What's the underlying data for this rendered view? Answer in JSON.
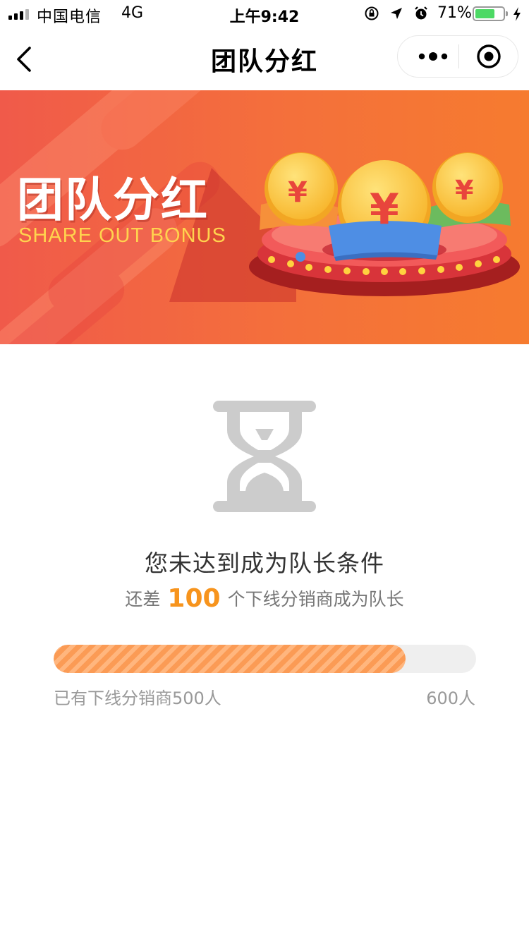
{
  "status_bar": {
    "carrier": "中国电信",
    "network": "4G",
    "time": "上午9:42",
    "battery_text": "71%",
    "battery_level": 0.71,
    "icons": [
      "signal-icon",
      "rotation-lock-icon",
      "location-arrow-icon",
      "alarm-icon",
      "battery-icon",
      "charging-icon"
    ]
  },
  "nav": {
    "title": "团队分红",
    "icons": [
      "back-chevron-icon",
      "more-dots-icon",
      "close-target-icon"
    ]
  },
  "banner": {
    "title": "团队分红",
    "subtitle": "SHARE OUT BONUS",
    "coin_symbol": "¥",
    "colors": {
      "background": "#f27a3a",
      "title": "#ffffff",
      "subtitle": "#ffd34e",
      "coin": "#ffcc3c"
    }
  },
  "status": {
    "icon": "hourglass-icon",
    "headline": "您未达到成为队长条件",
    "sub_prefix": "还差",
    "remaining": "100",
    "sub_suffix": "个下线分销商成为队长"
  },
  "progress": {
    "current_label": "已有下线分销商500人",
    "target_label": "600人",
    "current": 500,
    "target": 600,
    "fill_color": "#fb9b55",
    "track_color": "#efefef"
  },
  "accent_color": "#f7941d"
}
